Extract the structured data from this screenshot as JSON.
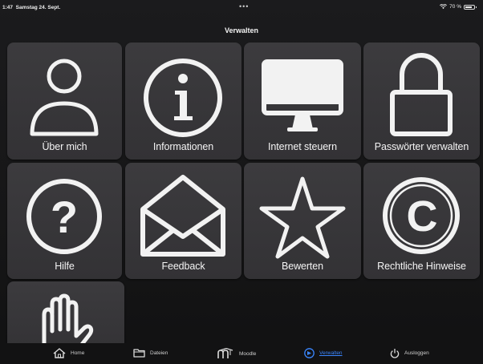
{
  "status_bar": {
    "time": "1:47",
    "date": "Samstag 24. Sept.",
    "dots": "•••",
    "battery": "70 %"
  },
  "header": {
    "title": "Verwalten"
  },
  "tiles": [
    {
      "label": "Über mich",
      "icon": "person-icon"
    },
    {
      "label": "Informationen",
      "icon": "info-icon"
    },
    {
      "label": "Internet steuern",
      "icon": "monitor-icon"
    },
    {
      "label": "Passwörter verwalten",
      "icon": "lock-icon"
    },
    {
      "label": "Hilfe",
      "icon": "question-icon"
    },
    {
      "label": "Feedback",
      "icon": "envelope-icon"
    },
    {
      "label": "Bewerten",
      "icon": "star-icon"
    },
    {
      "label": "Rechtliche Hinweise",
      "icon": "copyright-icon"
    },
    {
      "label": "",
      "icon": "hand-icon"
    }
  ],
  "tab_bar": {
    "items": [
      {
        "label": "Home",
        "icon": "home-icon",
        "active": false
      },
      {
        "label": "Dateien",
        "icon": "folder-icon",
        "active": false
      },
      {
        "label": "Moodle",
        "icon": "moodle-icon",
        "active": false
      },
      {
        "label": "Verwalten",
        "icon": "manage-icon",
        "active": true
      },
      {
        "label": "Ausloggen",
        "icon": "power-icon",
        "active": false
      }
    ]
  },
  "colors": {
    "accent": "#3a86ff",
    "tile": "#3a393c",
    "background": "#161617"
  }
}
